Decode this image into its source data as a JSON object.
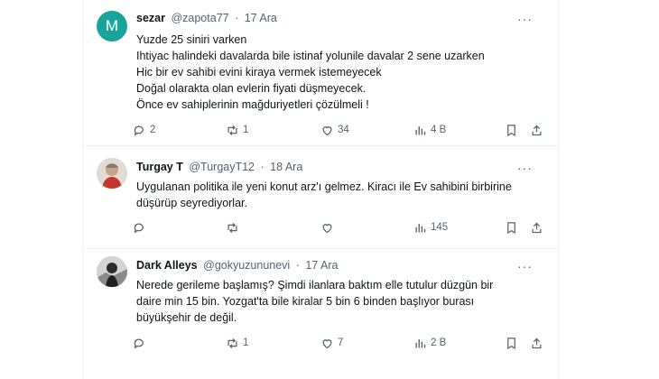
{
  "tweets": [
    {
      "avatar_letter": "M",
      "name": "sezar",
      "handle": "@zapota77",
      "dot": "·",
      "date": "17 Ara",
      "more": "···",
      "lines": [
        "Yuzde 25 siniri varken",
        "Ihtiyac halindeki davalarda bile istinaf yolunile davalar 2 sene uzarken",
        "Hic bir ev sahibi evini kiraya vermek istemeyecek",
        "Doğal olaraktа olan evlerin fiyati düşmeyecek.",
        "Önce ev sahiplerinin mağduriyetleri çözülmeli !"
      ],
      "replies": "2",
      "retweets": "1",
      "likes": "34",
      "views": "4 B"
    },
    {
      "name": "Turgay T",
      "handle": "@TurgayT12",
      "dot": "·",
      "date": "18 Ara",
      "more": "···",
      "lines": [
        "Uygulanan politika ile yeni konut arz'ı gelmez. Kiracı ile Ev sahibini birbirine",
        "düşürüp seyrediyorlar."
      ],
      "replies": "",
      "retweets": "",
      "likes": "",
      "views": "145"
    },
    {
      "name": "Dark Alleys",
      "handle": "@gokyuzununevi",
      "dot": "·",
      "date": "17 Ara",
      "more": "···",
      "lines": [
        "Nerede gerileme başlamış? Şimdi ilanlara baktım elle tutulur düzgün bir",
        "daire min 15 bin. Yozgat'ta bile kiralar 5 bin 6 binden başlıyor burası",
        "büyükşehir de değil."
      ],
      "replies": "",
      "retweets": "1",
      "likes": "7",
      "views": "2 B"
    }
  ],
  "colors": {
    "text": "#0f1419",
    "secondary": "#536471",
    "avatar_m": "#1aa39a",
    "border": "#eff3f4"
  },
  "icons": [
    "reply-icon",
    "retweet-icon",
    "like-icon",
    "views-icon",
    "bookmark-icon",
    "share-icon",
    "more-icon"
  ]
}
